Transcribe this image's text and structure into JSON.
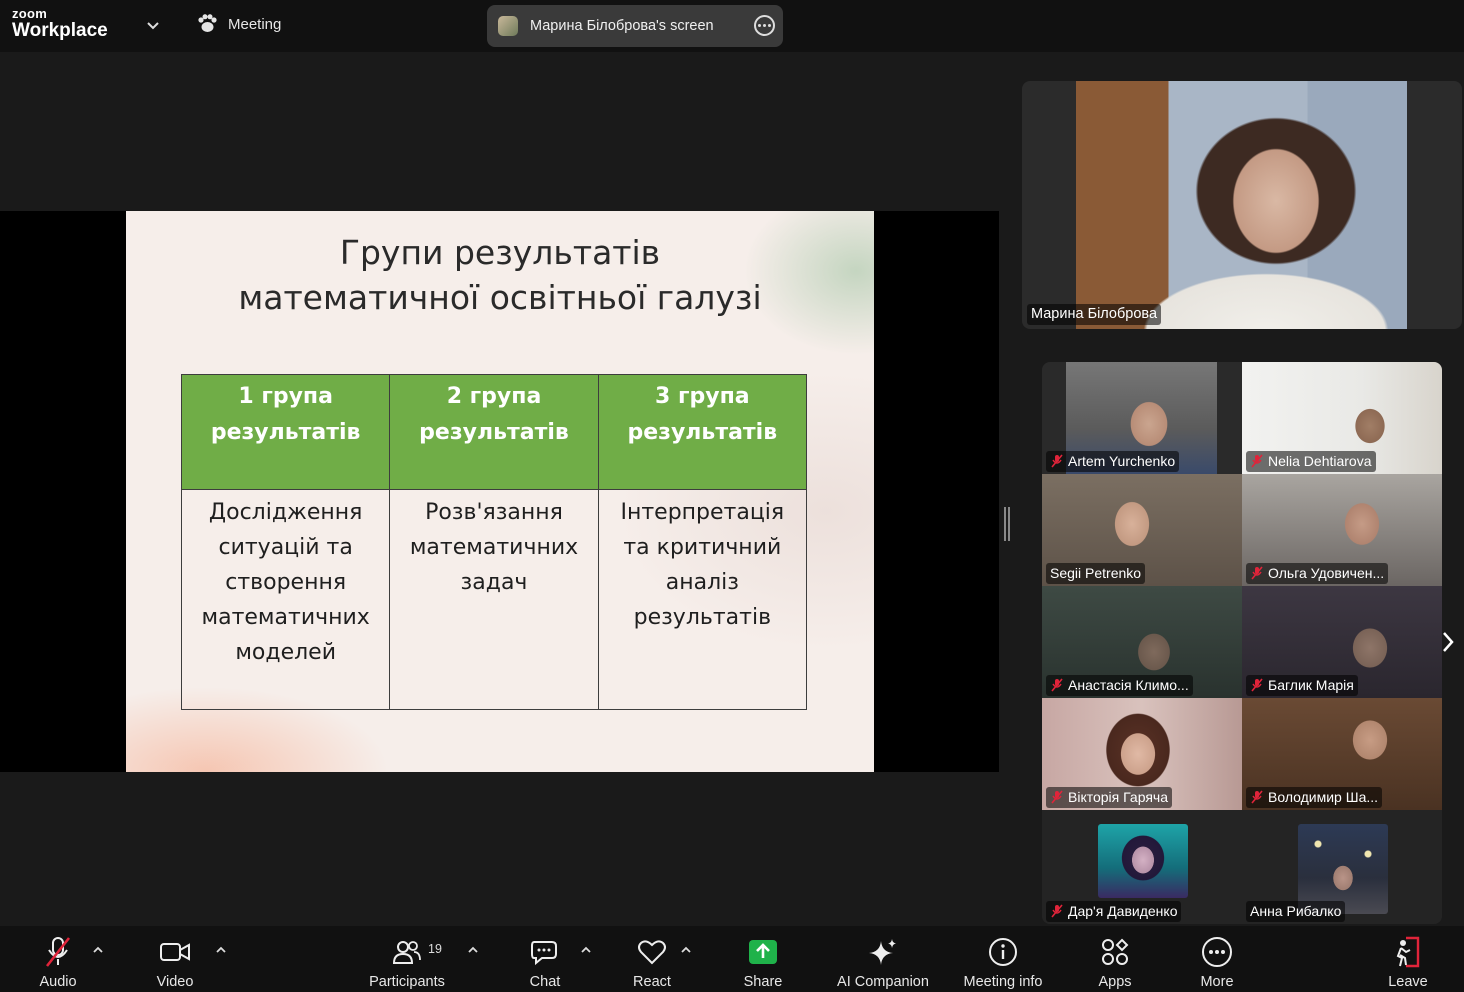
{
  "app": {
    "logo_small": "zoom",
    "logo_big": "Workplace",
    "meeting_label": "Meeting",
    "shared_screen_label": "Марина Білоброва's screen"
  },
  "slide": {
    "title_line1": "Групи результатів",
    "title_line2": "математичної освітньої галузі",
    "headers": [
      [
        "1 група",
        "результатів"
      ],
      [
        "2 група",
        "результатів"
      ],
      [
        "3 група",
        "результатів"
      ]
    ],
    "cells": [
      [
        "Дослідження",
        "ситуацій та",
        "створення",
        "математичних",
        "моделей"
      ],
      [
        "Розв'язання",
        "математичних",
        "задач"
      ],
      [
        "Інтерпретація",
        "та критичний",
        "аналіз",
        "результатів"
      ]
    ],
    "colors": {
      "header_green": "#70ad47",
      "slide_bg": "#f6eeea"
    }
  },
  "speaker": {
    "name": "Марина Білоброва"
  },
  "participants": [
    {
      "name": "Artem Yurchenko",
      "muted": true
    },
    {
      "name": "Nelia Dehtiarova",
      "muted": true
    },
    {
      "name": "Segii Petrenko",
      "muted": false
    },
    {
      "name": "Ольга Удовичен...",
      "muted": true
    },
    {
      "name": "Анастасія Климо...",
      "muted": true
    },
    {
      "name": "Баглик Марія",
      "muted": true
    },
    {
      "name": "Вікторія Гаряча",
      "muted": true
    },
    {
      "name": "Володимир Ша...",
      "muted": true
    },
    {
      "name": "Дар'я Давиденко",
      "muted": true
    },
    {
      "name": "Анна Рибалко",
      "muted": false
    }
  ],
  "toolbar": {
    "audio": "Audio",
    "video": "Video",
    "participants": "Participants",
    "participants_count": "19",
    "chat": "Chat",
    "react": "React",
    "share": "Share",
    "ai_companion": "AI Companion",
    "meeting_info": "Meeting info",
    "apps": "Apps",
    "more": "More",
    "leave": "Leave",
    "colors": {
      "share_green": "#1fb24a",
      "muted_red": "#e0243a",
      "leave_red": "#e0243a"
    }
  }
}
